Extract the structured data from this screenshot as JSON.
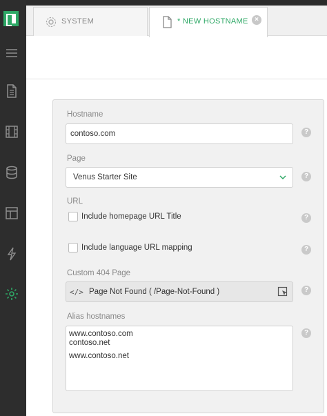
{
  "sidebar": {
    "items": [
      {
        "icon": "menu-icon"
      },
      {
        "icon": "document-icon"
      },
      {
        "icon": "film-icon"
      },
      {
        "icon": "database-icon"
      },
      {
        "icon": "layout-icon"
      },
      {
        "icon": "lightning-icon"
      },
      {
        "icon": "gear-icon",
        "active": true
      }
    ],
    "accent": "#2ea866"
  },
  "tabs": [
    {
      "label": "SYSTEM",
      "icon": "gear-icon"
    },
    {
      "label": "* NEW HOSTNAME",
      "icon": "document-icon",
      "close": "×"
    }
  ],
  "form": {
    "hostname": {
      "label": "Hostname",
      "value": "contoso.com"
    },
    "page": {
      "label": "Page",
      "value": "Venus Starter Site"
    },
    "url": {
      "label": "URL",
      "include_title": "Include homepage URL Title",
      "include_language": "Include language URL mapping"
    },
    "custom404": {
      "label": "Custom 404 Page",
      "code": "</>",
      "value": "Page Not Found ( /Page-Not-Found )"
    },
    "aliases": {
      "label": "Alias hostnames",
      "values": [
        "www.contoso.com",
        "contoso.net",
        "www.contoso.net"
      ]
    },
    "help": "?"
  }
}
